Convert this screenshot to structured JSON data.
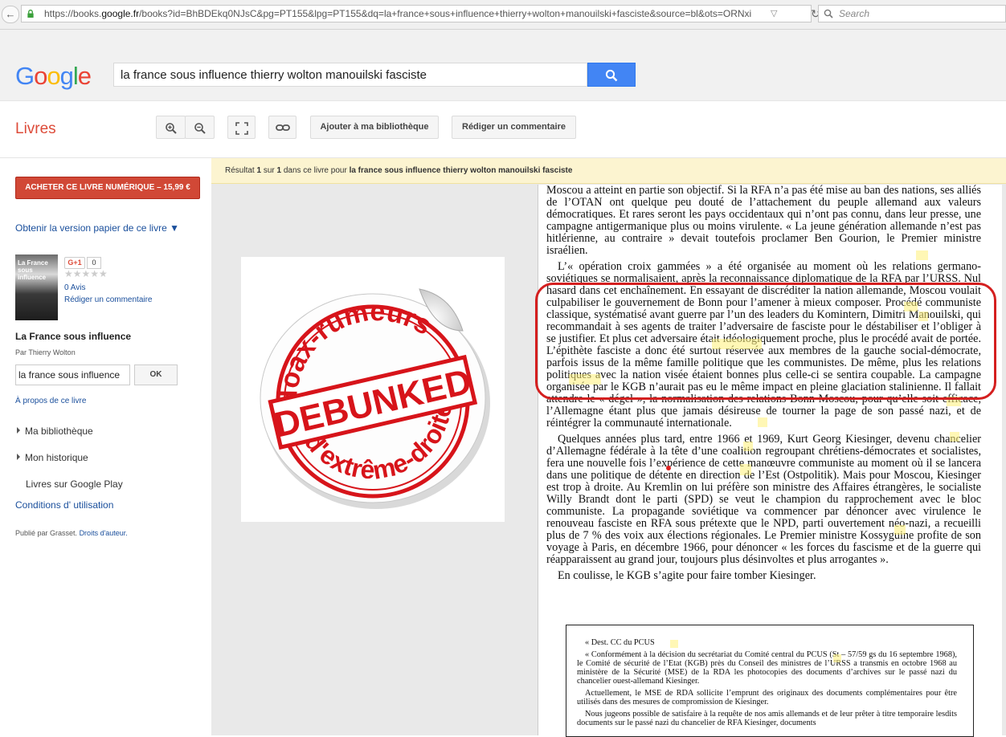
{
  "browser": {
    "url_prefix": "https://books.",
    "url_domain": "google.fr",
    "url_rest": "/books?id=BhBDEkq0NJsC&pg=PT155&lpg=PT155&dq=la+france+sous+influence+thierry+wolton+manouilski+fasciste&source=bl&ots=ORNxi",
    "search_placeholder": "Search"
  },
  "header": {
    "logo_letters": [
      "G",
      "o",
      "o",
      "g",
      "l",
      "e"
    ],
    "query": "la france sous influence thierry wolton manouilski fasciste"
  },
  "toolbar": {
    "section": "Livres",
    "add_library": "Ajouter à ma bibliothèque",
    "write_review": "Rédiger un commentaire"
  },
  "sidebar": {
    "buy_label": "ACHETER CE LIVRE NUMÉRIQUE – 15,99 €",
    "paper_version": "Obtenir la version papier de ce livre ▼",
    "cover_title": "La France sous influence",
    "cover_red": "influence",
    "gplus": "G+1",
    "gplus_count": "0",
    "stars": "★★★★★",
    "reviews": "0 Avis",
    "write_comment": "Rédiger un commentaire",
    "book_title": "La France sous influence",
    "author": "Par Thierry Wolton",
    "search_value": "la france sous influence",
    "ok": "OK",
    "about": "À propos de ce livre",
    "nav": [
      "Ma bibliothèque",
      "Mon historique"
    ],
    "play": "Livres sur Google Play",
    "terms": "Conditions d' utilisation",
    "published_by": "Publié par Grasset.",
    "rights": "Droits d'auteur."
  },
  "result": {
    "prefix": "Résultat",
    "num": "1",
    "of": "sur",
    "total": "1",
    "in_book": "dans ce livre pour",
    "query": "la france sous influence thierry wolton manouilski fasciste"
  },
  "stamp": {
    "top_text": "Hoax-rumeurs",
    "center_text": "DEBUNKED",
    "bottom_text": "d'extrême-droite",
    "color": "#d7141a"
  },
  "page": {
    "paragraphs": [
      "Moscou a atteint en partie son objectif. Si la RFA n’a pas été mise au ban des nations, ses alliés de l’OTAN ont quelque peu douté de l’attachement du peuple allemand aux valeurs démocratiques. Et rares seront les pays occidentaux qui n’ont pas connu, dans leur presse, une campagne antigermanique plus ou moins virulente. « La jeune génération allemande n’est pas hitlérienne, au contraire » devait toutefois proclamer Ben Gourion, le Premier ministre israélien.",
      "L’« opération croix gammées » a été organisée au moment où les relations germano-soviétiques se normalisaient, après la reconnaissance diplomatique de la RFA par l’URSS. Nul hasard dans cet enchaînement. En essayant de discréditer la nation allemande, Moscou voulait culpabiliser le gouvernement de Bonn pour l’amener à mieux composer. Procédé communiste classique, systématisé avant guerre par l’un des leaders du Komintern, Dimitri Manouilski, qui recommandait à ses agents de traiter l’adversaire de fasciste pour le déstabiliser et l’obliger à se justifier. Et plus cet adversaire était idéologiquement proche, plus le procédé avait de portée. L’épithète fasciste a donc été surtout réservée aux membres de la gauche social-démocrate, parfois issus de la même famille politique que les communistes. De même, plus les relations politiques avec la nation visée étaient bonnes plus celle-ci se sentira coupable. La campagne organisée par le KGB n’aurait pas eu le même impact en pleine glaciation stalinienne. Il fallait attendre le « dégel », la normalisation des relations Bonn-Moscou, pour qu’elle soit efficace, l’Allemagne étant plus que jamais désireuse de tourner la page de son passé nazi, et de réintégrer la communauté internationale.",
      "Quelques années plus tard, entre 1966 et 1969, Kurt Georg Kiesinger, devenu chancelier d’Allemagne fédérale à la tête d’une coalition regroupant chrétiens-démocrates et socialistes, fera une nouvelle fois l’expérience de cette manœuvre communiste au moment où il se lancera dans une politique de détente en direction de l’Est (Ostpolitik). Mais pour Moscou, Kiesinger est trop à droite. Au Kremlin on lui préfère son ministre des Affaires étrangères, le socialiste Willy Brandt dont le parti (SPD) se veut le champion du rapprochement avec le bloc communiste. La propagande soviétique va commencer par dénoncer avec virulence le renouveau fasciste en RFA sous prétexte que le NPD, parti ouvertement néo-nazi, a recueilli plus de 7 % des voix aux élections régionales. Le Premier ministre Kossyguine profite de son voyage à Paris, en décembre 1966, pour dénoncer « les forces du fascisme et de la guerre qui réapparaissent au grand jour, toujours plus désinvoltes et plus arrogantes ».",
      "En coulisse, le KGB s’agite pour faire tomber Kiesinger."
    ],
    "doc": [
      "« Dest. CC du PCUS",
      "« Conformément à la décision du secrétariat du Comité central du PCUS (St – 57/59 gs du 16 septembre 1968), le Comité de sécurité de l’Etat (KGB) près du Conseil des ministres de l’URSS a transmis en octobre 1968 au ministère de la Sécurité (MSE) de la RDA les photocopies des documents d’archives sur le passé nazi du chancelier ouest-allemand Kiesinger.",
      "Actuellement, le MSE de RDA sollicite l’emprunt des originaux des documents complémentaires pour être utilisés dans des mesures de compromission de Kiesinger.",
      "Nous jugeons possible de satisfaire à la requête de nos amis allemands et de leur prêter à titre temporaire lesdits documents sur le passé nazi du chancelier de RFA Kiesinger, documents"
    ]
  },
  "colors": {
    "google_blue": "#4285f4",
    "buy_red": "#d14836",
    "link_blue": "#1a4f9c",
    "annotation_red": "#d41f1f"
  }
}
